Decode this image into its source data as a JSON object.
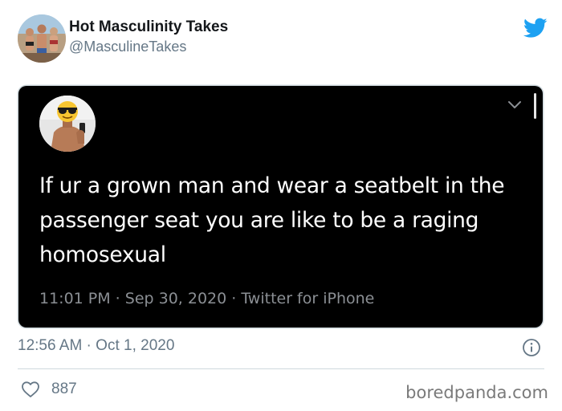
{
  "author": {
    "name": "Hot Masculinity Takes",
    "handle": "@MasculineTakes"
  },
  "embedded_tweet": {
    "text": "If ur a grown man and wear a seatbelt in the passenger seat you are like to be a raging homosexual",
    "meta": "11:01 PM · Sep 30, 2020 · Twitter for iPhone"
  },
  "tweet": {
    "timestamp": "12:56 AM · Oct 1, 2020",
    "likes": "887"
  },
  "watermark": "boredpanda.com",
  "icons": {
    "brand": "twitter-bird-icon",
    "info": "info-icon",
    "like": "heart-icon",
    "menu": "chevron-down-icon"
  },
  "colors": {
    "twitter_blue": "#1da1f2",
    "secondary_text": "#657786",
    "embedded_bg": "#000000",
    "embedded_meta": "#8b8f94"
  }
}
